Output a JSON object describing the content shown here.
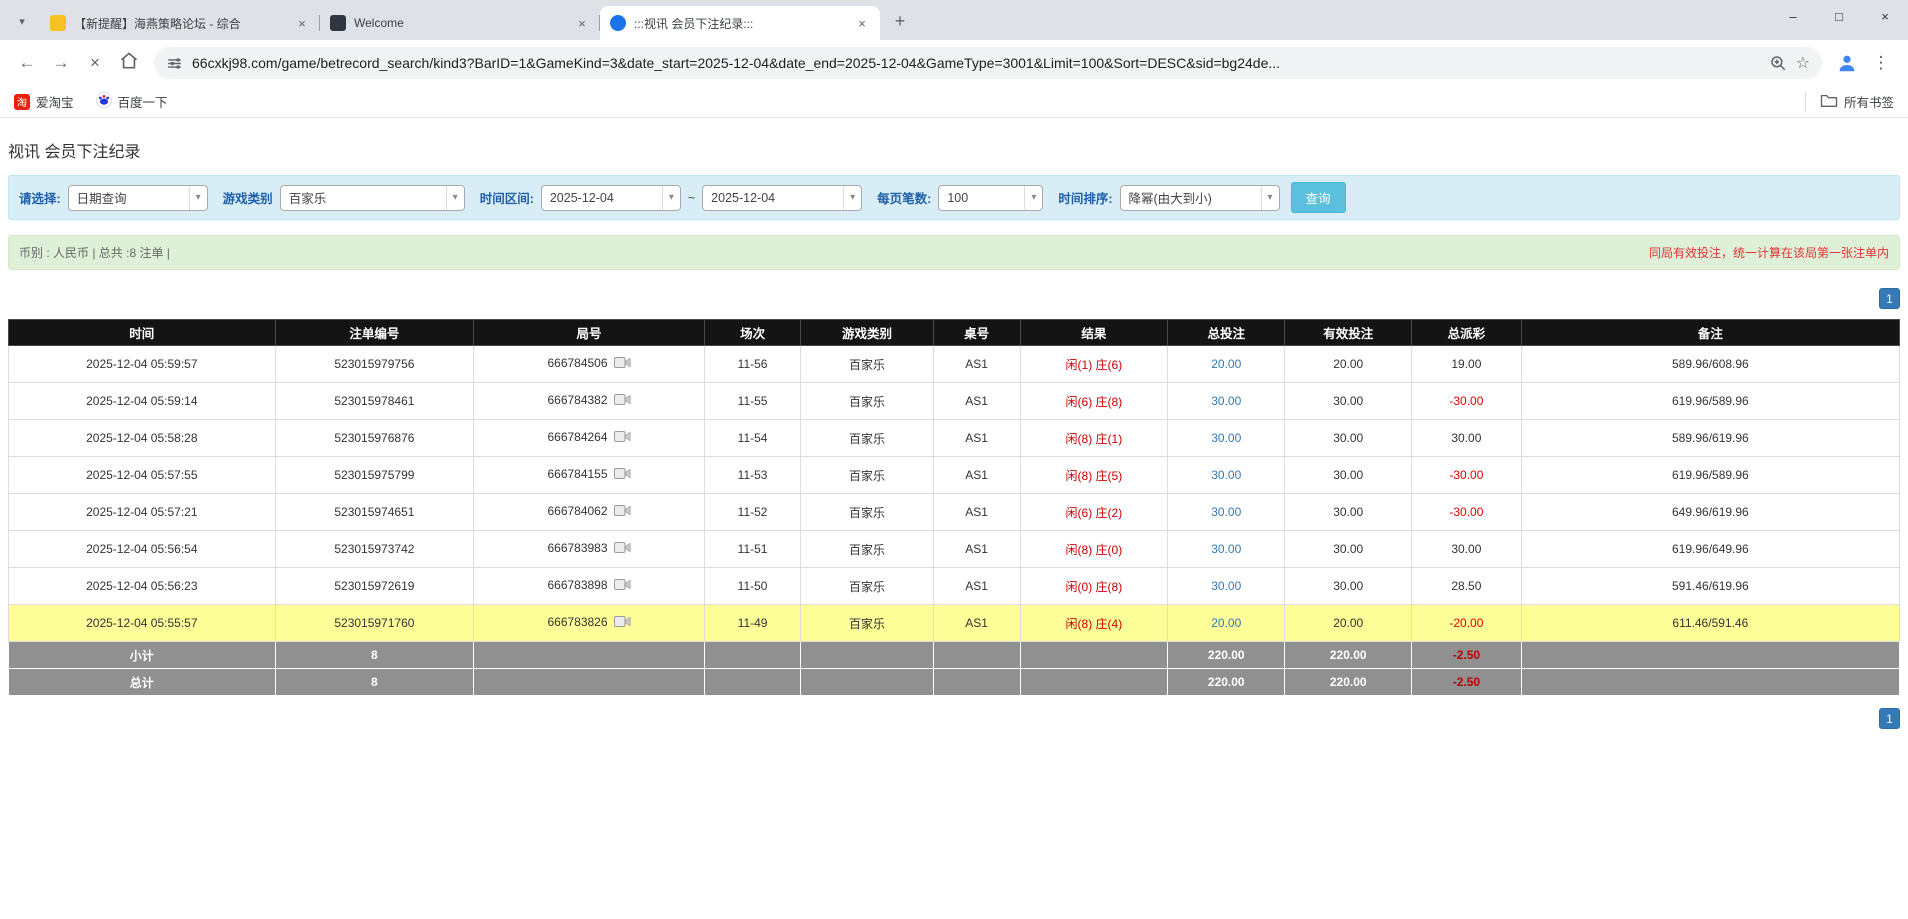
{
  "icons": {
    "caret": "▾",
    "close": "×",
    "plus": "+",
    "minimize": "–",
    "maximize": "□",
    "back": "←",
    "forward": "→",
    "stop": "×",
    "kebab": "⋮",
    "star": "☆"
  },
  "browser": {
    "tabs": [
      {
        "title": "【新提醒】海燕策略论坛 - 综合"
      },
      {
        "title": "Welcome"
      },
      {
        "title": ":::视讯 会员下注纪录:::"
      }
    ],
    "url": "66cxkj98.com/game/betrecord_search/kind3?BarID=1&GameKind=3&date_start=2025-12-04&date_end=2025-12-04&GameType=3001&Limit=100&Sort=DESC&sid=bg24de...",
    "bookmarks": [
      {
        "label": "爱淘宝"
      },
      {
        "label": "百度一下"
      }
    ],
    "all_bookmarks": "所有书签"
  },
  "page": {
    "title": "视讯 会员下注纪录",
    "filters": {
      "select_label": "请选择:",
      "select_value": "日期查询",
      "game_label": "游戏类别",
      "game_value": "百家乐",
      "range_label": "时间区间:",
      "date_start": "2025-12-04",
      "tilde": "~",
      "date_end": "2025-12-04",
      "page_size_label": "每页笔数:",
      "page_size_value": "100",
      "sort_label": "时间排序:",
      "sort_value": "降幂(由大到小)",
      "search_button": "查询"
    },
    "summary": {
      "left": "币别 : 人民币 | 总共 :8 注单 |",
      "right": "同局有效投注，统一计算在该局第一张注单内"
    },
    "pagination": {
      "page": "1"
    },
    "table": {
      "headers": [
        "时间",
        "注单编号",
        "局号",
        "场次",
        "游戏类别",
        "桌号",
        "结果",
        "总投注",
        "有效投注",
        "总派彩",
        "备注"
      ],
      "rows": [
        {
          "time": "2025-12-04 05:59:57",
          "bet_id": "523015979756",
          "round": "666784506",
          "session": "11-56",
          "game": "百家乐",
          "table_no": "AS1",
          "result_player": "闲(1)",
          "result_banker": "庄(6)",
          "total_bet": "20.00",
          "valid_bet": "20.00",
          "payout": "19.00",
          "note": "589.96/608.96",
          "highlight": false
        },
        {
          "time": "2025-12-04 05:59:14",
          "bet_id": "523015978461",
          "round": "666784382",
          "session": "11-55",
          "game": "百家乐",
          "table_no": "AS1",
          "result_player": "闲(6)",
          "result_banker": "庄(8)",
          "total_bet": "30.00",
          "valid_bet": "30.00",
          "payout": "-30.00",
          "note": "619.96/589.96",
          "highlight": false
        },
        {
          "time": "2025-12-04 05:58:28",
          "bet_id": "523015976876",
          "round": "666784264",
          "session": "11-54",
          "game": "百家乐",
          "table_no": "AS1",
          "result_player": "闲(8)",
          "result_banker": "庄(1)",
          "total_bet": "30.00",
          "valid_bet": "30.00",
          "payout": "30.00",
          "note": "589.96/619.96",
          "highlight": false
        },
        {
          "time": "2025-12-04 05:57:55",
          "bet_id": "523015975799",
          "round": "666784155",
          "session": "11-53",
          "game": "百家乐",
          "table_no": "AS1",
          "result_player": "闲(8)",
          "result_banker": "庄(5)",
          "total_bet": "30.00",
          "valid_bet": "30.00",
          "payout": "-30.00",
          "note": "619.96/589.96",
          "highlight": false
        },
        {
          "time": "2025-12-04 05:57:21",
          "bet_id": "523015974651",
          "round": "666784062",
          "session": "11-52",
          "game": "百家乐",
          "table_no": "AS1",
          "result_player": "闲(6)",
          "result_banker": "庄(2)",
          "total_bet": "30.00",
          "valid_bet": "30.00",
          "payout": "-30.00",
          "note": "649.96/619.96",
          "highlight": false
        },
        {
          "time": "2025-12-04 05:56:54",
          "bet_id": "523015973742",
          "round": "666783983",
          "session": "11-51",
          "game": "百家乐",
          "table_no": "AS1",
          "result_player": "闲(8)",
          "result_banker": "庄(0)",
          "total_bet": "30.00",
          "valid_bet": "30.00",
          "payout": "30.00",
          "note": "619.96/649.96",
          "highlight": false
        },
        {
          "time": "2025-12-04 05:56:23",
          "bet_id": "523015972619",
          "round": "666783898",
          "session": "11-50",
          "game": "百家乐",
          "table_no": "AS1",
          "result_player": "闲(0)",
          "result_banker": "庄(8)",
          "total_bet": "30.00",
          "valid_bet": "30.00",
          "payout": "28.50",
          "note": "591.46/619.96",
          "highlight": false
        },
        {
          "time": "2025-12-04 05:55:57",
          "bet_id": "523015971760",
          "round": "666783826",
          "session": "11-49",
          "game": "百家乐",
          "table_no": "AS1",
          "result_player": "闲(8)",
          "result_banker": "庄(4)",
          "total_bet": "20.00",
          "valid_bet": "20.00",
          "payout": "-20.00",
          "note": "611.46/591.46",
          "highlight": true
        }
      ],
      "subtotal": {
        "label": "小计",
        "count": "8",
        "total_bet": "220.00",
        "valid_bet": "220.00",
        "payout": "-2.50"
      },
      "total": {
        "label": "总计",
        "count": "8",
        "total_bet": "220.00",
        "valid_bet": "220.00",
        "payout": "-2.50"
      }
    }
  }
}
